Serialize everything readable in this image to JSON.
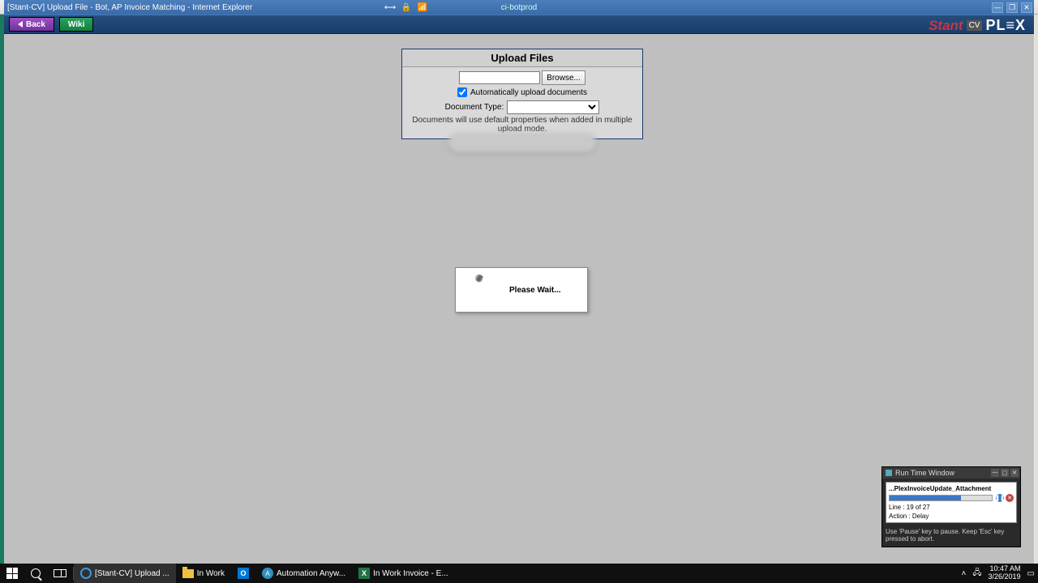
{
  "outer_window": {
    "min": "—",
    "max": "▢",
    "close": "✕"
  },
  "ie": {
    "title": "[Stant-CV] Upload File - Bot, AP Invoice Matching - Internet Explorer",
    "site": "ci-botprod",
    "min": "—",
    "max": "❐",
    "close": "✕"
  },
  "toolbar": {
    "back": "Back",
    "wiki": "Wiki"
  },
  "brand": {
    "stant": "Stant",
    "cv": "CV",
    "plex": "PL≡X"
  },
  "upload": {
    "title": "Upload Files",
    "browse": "Browse...",
    "auto_label": "Automatically upload documents",
    "doctype_label": "Document Type:",
    "note": "Documents will use default properties when added in multiple upload mode."
  },
  "wait": {
    "text": "Please Wait..."
  },
  "rtw": {
    "title": "Run Time Window",
    "script": "...PlexInvoiceUpdate_Attachment",
    "line": "Line :  19 of 27",
    "action": "Action :  Delay",
    "hint": "Use 'Pause' key to pause. Keep 'Esc' key pressed to abort."
  },
  "taskbar": {
    "ie_task": "[Stant-CV] Upload ...",
    "inwork": "In Work",
    "aa": "Automation Anyw...",
    "excel": "In Work Invoice - E...",
    "time": "10:47 AM",
    "date": "3/26/2019"
  }
}
